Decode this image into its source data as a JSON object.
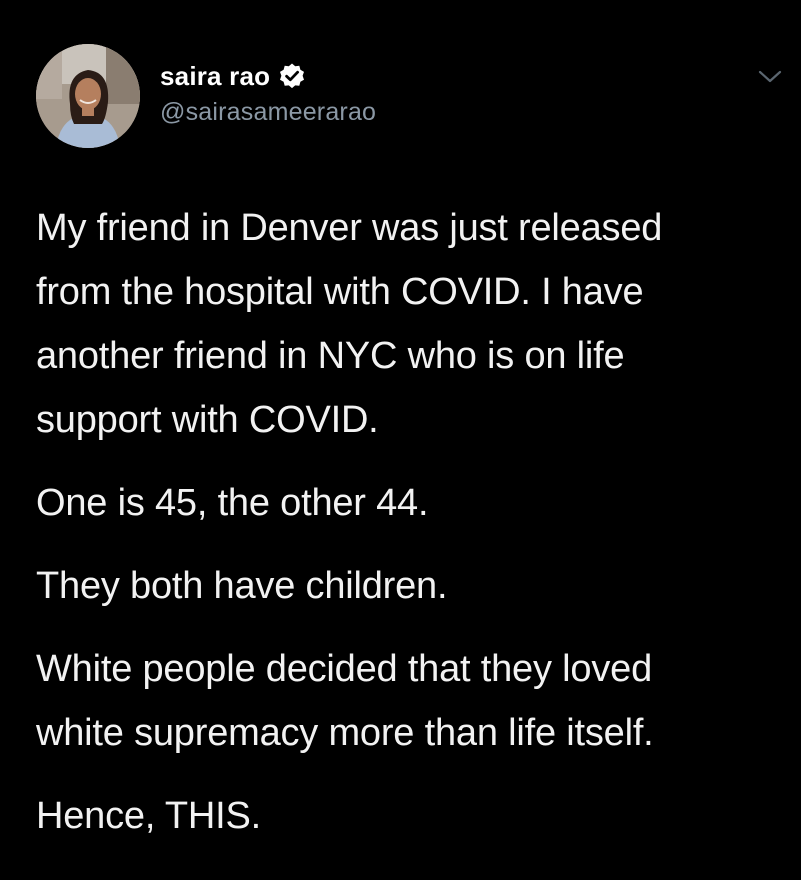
{
  "tweet": {
    "author": {
      "display_name": "saira rao",
      "handle": "@sairasameerarao",
      "verified": true,
      "avatar_icon": "profile-photo"
    },
    "menu_icon": "chevron-down-icon",
    "paragraphs": [
      {
        "lines": [
          "My friend in Denver was just released",
          "from the hospital with COVID. I have",
          "another friend in NYC who is on life",
          "support with COVID."
        ]
      },
      {
        "lines": [
          "One is 45, the other 44."
        ]
      },
      {
        "lines": [
          "They both have children."
        ]
      },
      {
        "lines": [
          "White people decided that they loved",
          "white supremacy more than life itself."
        ]
      },
      {
        "lines": [
          "Hence, THIS."
        ]
      }
    ]
  },
  "colors": {
    "background": "#000000",
    "name": "#ffffff",
    "handle": "#8b98a5",
    "body_text": "#f2f2f2",
    "verified_badge": "#ffffff"
  }
}
